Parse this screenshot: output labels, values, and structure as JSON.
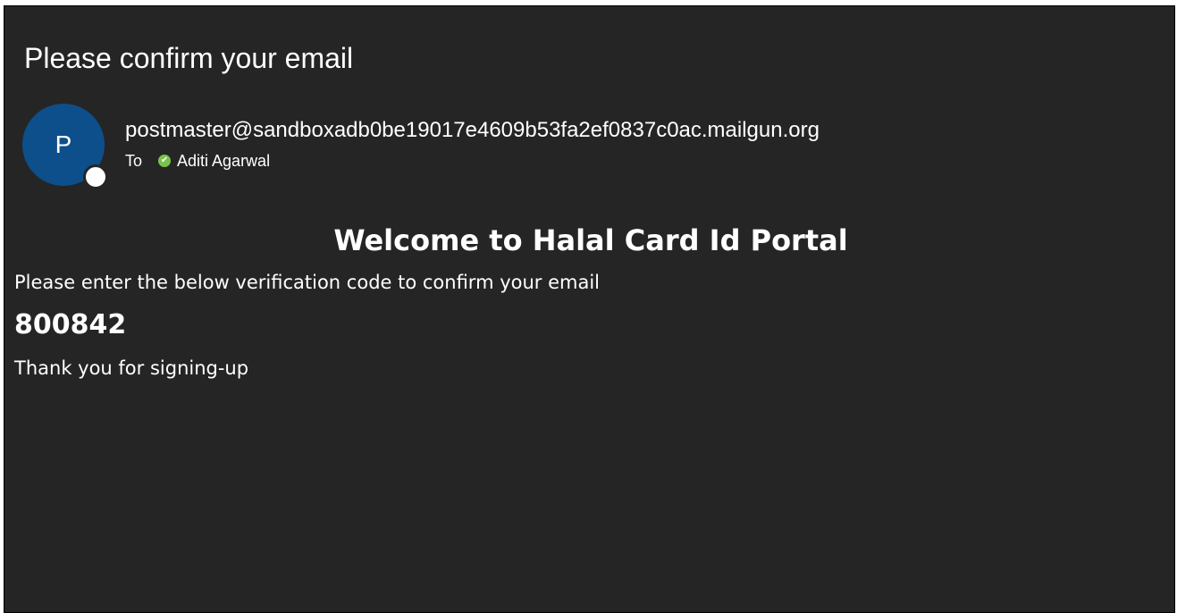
{
  "email": {
    "subject": "Please confirm your email",
    "sender": {
      "avatar_initial": "P",
      "address": "postmaster@sandboxadb0be19017e4609b53fa2ef0837c0ac.mailgun.org",
      "avatar_color": "#0d4f8b"
    },
    "recipient": {
      "to_label": "To",
      "name": "Aditi Agarwal",
      "status_color": "#7cc24a"
    },
    "body": {
      "heading": "Welcome to Halal Card Id Portal",
      "instructions": "Please enter the below verification code to confirm your email",
      "code": "800842",
      "closing": "Thank you for signing-up"
    }
  }
}
